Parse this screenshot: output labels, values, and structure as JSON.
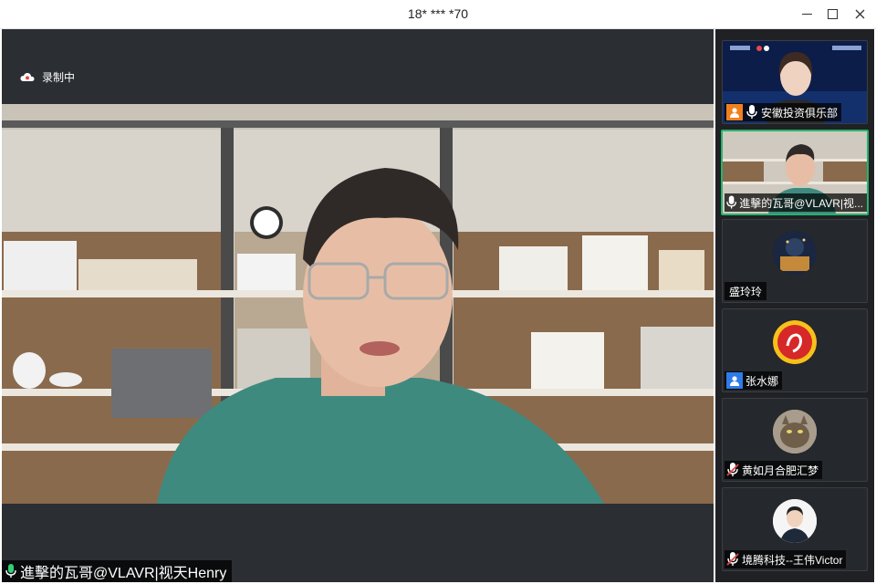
{
  "window": {
    "title": "18* *** *70"
  },
  "stage": {
    "recording_label": "录制中",
    "speaker_label": "進擊的瓦哥@VLAVR|视天Henry"
  },
  "participants": [
    {
      "name": "安徽投资俱乐部",
      "role_icon": "person-icon",
      "mic": "on"
    },
    {
      "name": "進擊的瓦哥@VLAVR|视...",
      "mic": "on",
      "active": true
    },
    {
      "name": "盛玲玲"
    },
    {
      "name": "张水娜",
      "role_icon": "person-icon"
    },
    {
      "name": "黄如月合肥汇梦",
      "mic": "muted"
    },
    {
      "name": "境腾科技--王伟Victor",
      "mic": "muted"
    }
  ],
  "colors": {
    "active_border": "#27b36b",
    "host_badge": "#f0801e",
    "user_badge": "#2f7be8",
    "stage_bg": "#2b2e32"
  }
}
